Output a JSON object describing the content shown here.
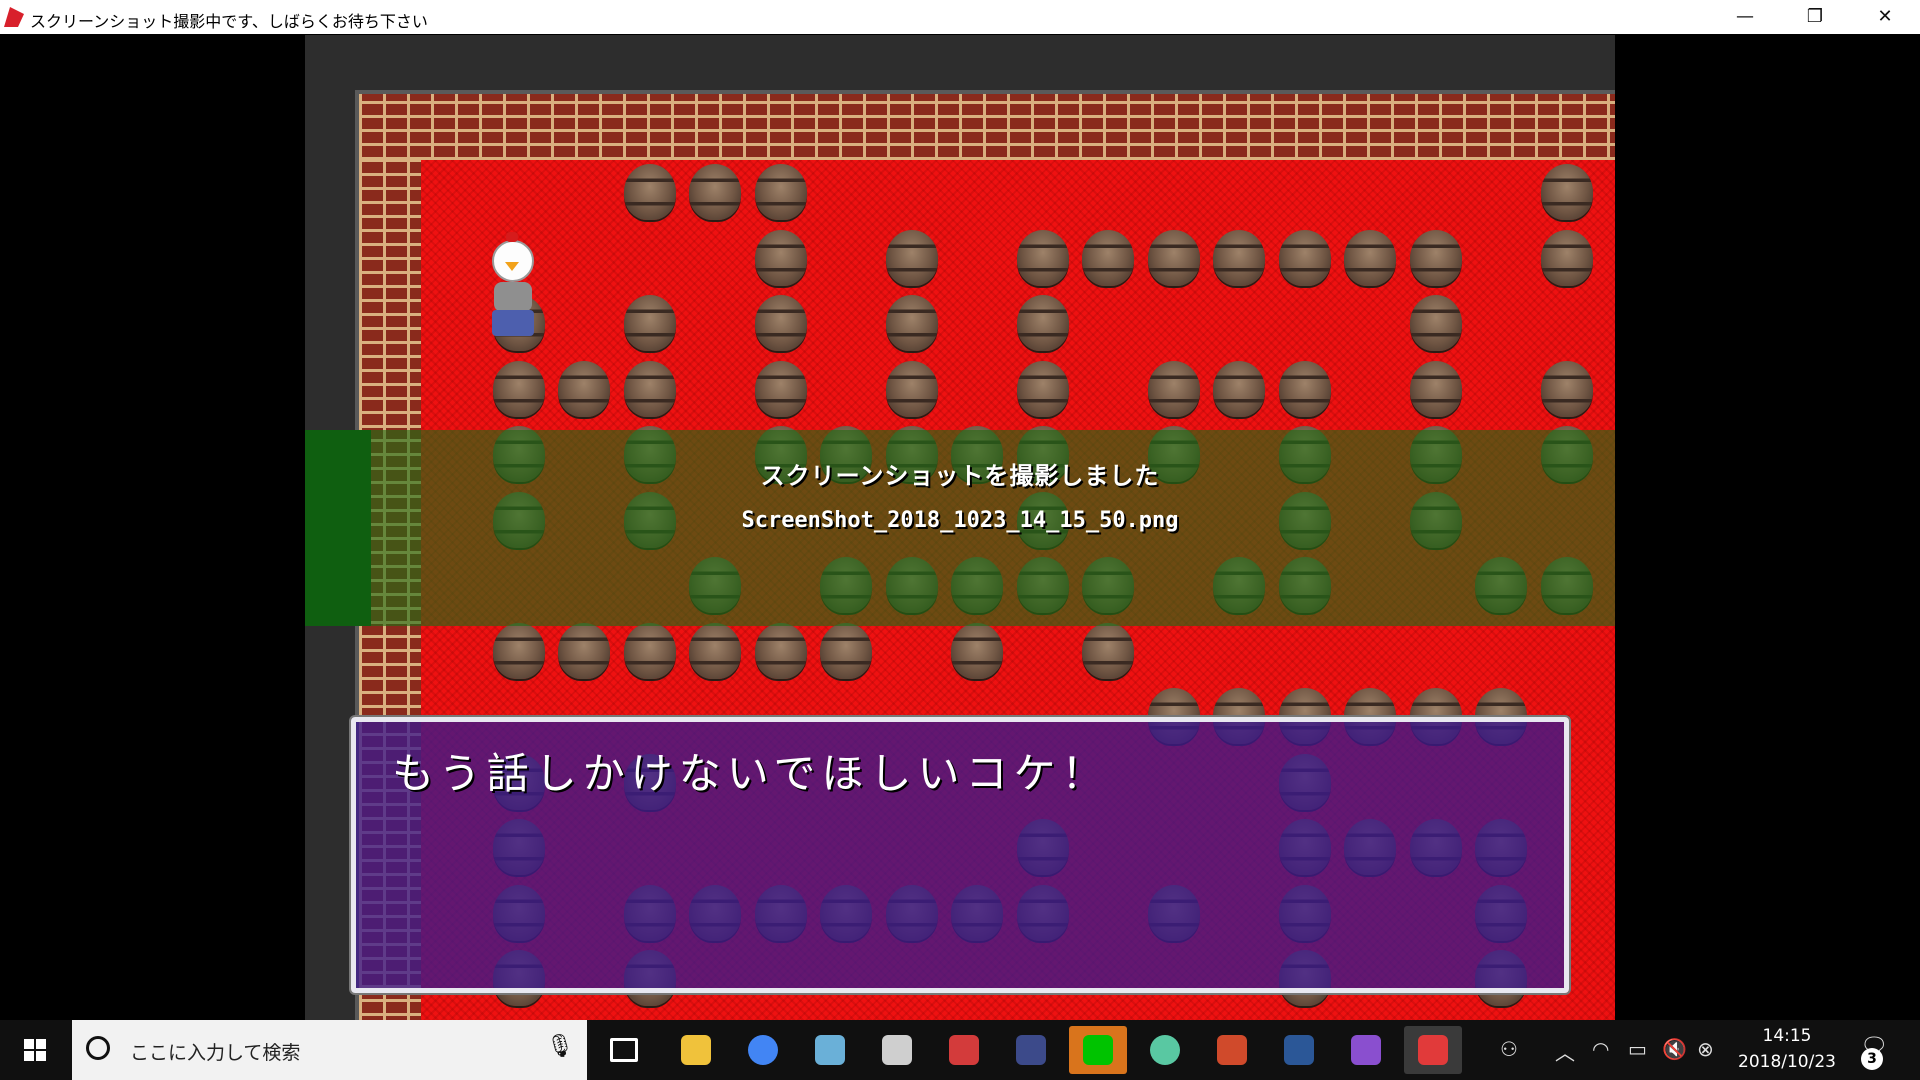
{
  "window": {
    "title": "スクリーンショット撮影中です、しばらくお待ち下さい",
    "minimize_glyph": "—",
    "maximize_glyph": "❐",
    "close_glyph": "✕"
  },
  "game": {
    "notice_title": "スクリーンショットを撮影しました",
    "notice_filename": "ScreenShot_2018_1023_14_15_50.png",
    "message": "もう話しかけないでほしいコケ！"
  },
  "taskbar": {
    "search_placeholder": "ここに入力して検索",
    "mic_icon": "🎙",
    "icons": [
      "task-view-icon",
      "file-explorer-icon",
      "chrome-icon",
      "sketch-app-icon",
      "notepad-icon",
      "paint-app-icon",
      "media-app-icon",
      "line-icon",
      "atom-icon",
      "powerpoint-icon",
      "word-icon",
      "visual-studio-icon",
      "game-app-icon"
    ],
    "icon_colors": [
      "#ffffff",
      "#f0c23b",
      "#4285f4",
      "#6ab0d8",
      "#cfcfcf",
      "#d33b3b",
      "#3c4a8a",
      "#00c300",
      "#59c8a2",
      "#d04a2b",
      "#2b5797",
      "#8a4fcf",
      "#e13a3a"
    ]
  },
  "tray": {
    "time": "14:15",
    "date": "2018/10/23",
    "notification_count": "3",
    "people_glyph": "⚇",
    "chevron_glyph": "︿",
    "wifi_glyph": "◠",
    "battery_glyph": "▭",
    "volume_glyph": "🔇",
    "error_glyph": "⊗",
    "action_center_glyph": "🗨"
  }
}
